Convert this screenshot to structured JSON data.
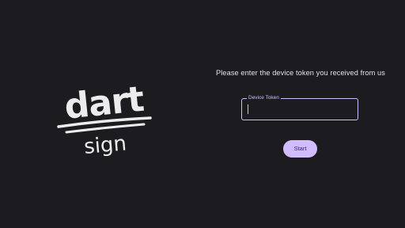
{
  "logo": {
    "word_top": "dart",
    "word_bottom": "sign"
  },
  "form": {
    "prompt": "Please enter the device token you received from us",
    "token_label": "Device Token",
    "token_value": "",
    "start_label": "Start"
  },
  "colors": {
    "background": "#1c1b1f",
    "accent": "#d0bcff",
    "button_text": "#381e72",
    "text": "#e6e1e5"
  }
}
